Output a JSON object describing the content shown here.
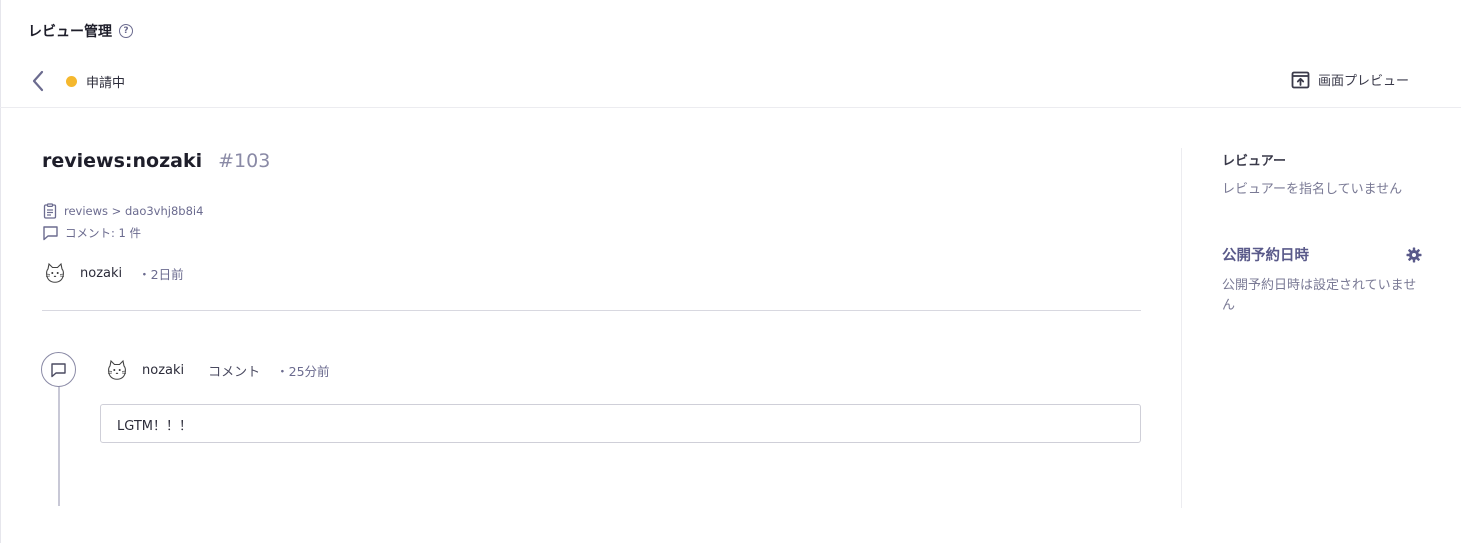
{
  "header": {
    "title": "レビュー管理",
    "help_icon": "?"
  },
  "toolbar": {
    "back_icon": "chevron-left-icon",
    "status": {
      "label": "申請中",
      "color": "#f5b82e"
    },
    "preview": {
      "label": "画面プレビュー",
      "icon": "preview-upload-icon"
    }
  },
  "review": {
    "title": "reviews:nozaki",
    "number": "#103",
    "path": "reviews > dao3vhj8b8i4",
    "comment_count": "コメント: 1 件",
    "author": {
      "name": "nozaki",
      "time": "・2日前"
    }
  },
  "timeline": [
    {
      "author": "nozaki",
      "kind": "コメント",
      "time": "・25分前",
      "body": "LGTM！！！"
    }
  ],
  "sidebar": {
    "reviewers": {
      "heading": "レビュアー",
      "empty_text": "レビュアーを指名していません"
    },
    "schedule": {
      "heading": "公開予約日時",
      "empty_text": "公開予約日時は設定されていません"
    }
  },
  "colors": {
    "accent": "#5a5a8a",
    "status_pending": "#f5b82e",
    "text_muted": "#7a7a95"
  }
}
